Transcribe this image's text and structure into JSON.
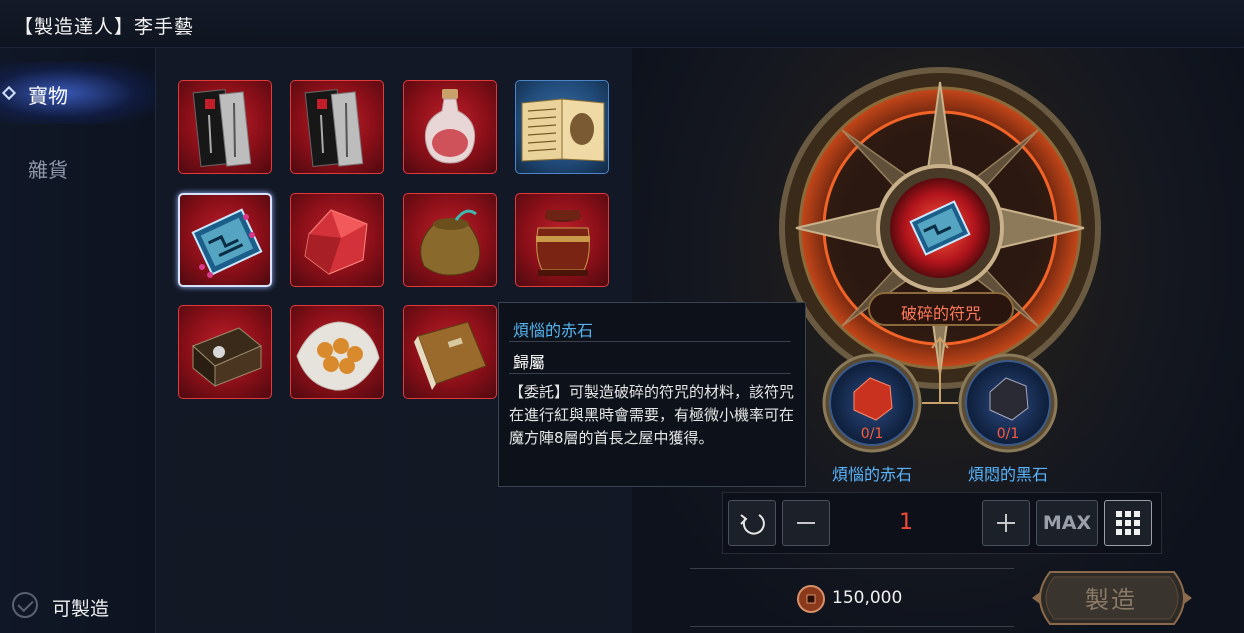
{
  "window": {
    "title": "【製造達人】李手藝"
  },
  "sidebar": {
    "tabs": [
      {
        "label": "寶物",
        "active": true
      },
      {
        "label": "雜貨",
        "active": false
      }
    ],
    "filter_label": "可製造"
  },
  "items": [
    {
      "name": "scroll-item",
      "frame": "red"
    },
    {
      "name": "scroll-item",
      "frame": "red"
    },
    {
      "name": "potion-vase-item",
      "frame": "red"
    },
    {
      "name": "open-book-item",
      "frame": "blue"
    },
    {
      "name": "talisman-item",
      "frame": "red",
      "selected": true
    },
    {
      "name": "red-crystal-item",
      "frame": "red"
    },
    {
      "name": "pouch-item",
      "frame": "red"
    },
    {
      "name": "urn-item",
      "frame": "red"
    },
    {
      "name": "chest-item",
      "frame": "red"
    },
    {
      "name": "pearls-item",
      "frame": "red"
    },
    {
      "name": "tome-item",
      "frame": "red"
    }
  ],
  "tooltip": {
    "name": "煩惱的赤石",
    "binding": "歸屬",
    "description": "【委託】可製造破碎的符咒的材料，該符咒在進行紅與黑時會需要，有極微小機率可在魔方陣8層的首長之屋中獲得。"
  },
  "recipe": {
    "result_name": "破碎的符咒",
    "materials": [
      {
        "count": "0/1",
        "name": "煩惱的赤石"
      },
      {
        "count": "0/1",
        "name": "煩悶的黑石"
      }
    ]
  },
  "quantity": {
    "value": "1",
    "max_label": "MAX"
  },
  "cost": {
    "amount": "150,000"
  },
  "make_button": {
    "label": "製造"
  },
  "colors": {
    "accent_red": "#f04a3a",
    "tooltip_title": "#58b4f0",
    "material_name": "#59b6ff"
  }
}
